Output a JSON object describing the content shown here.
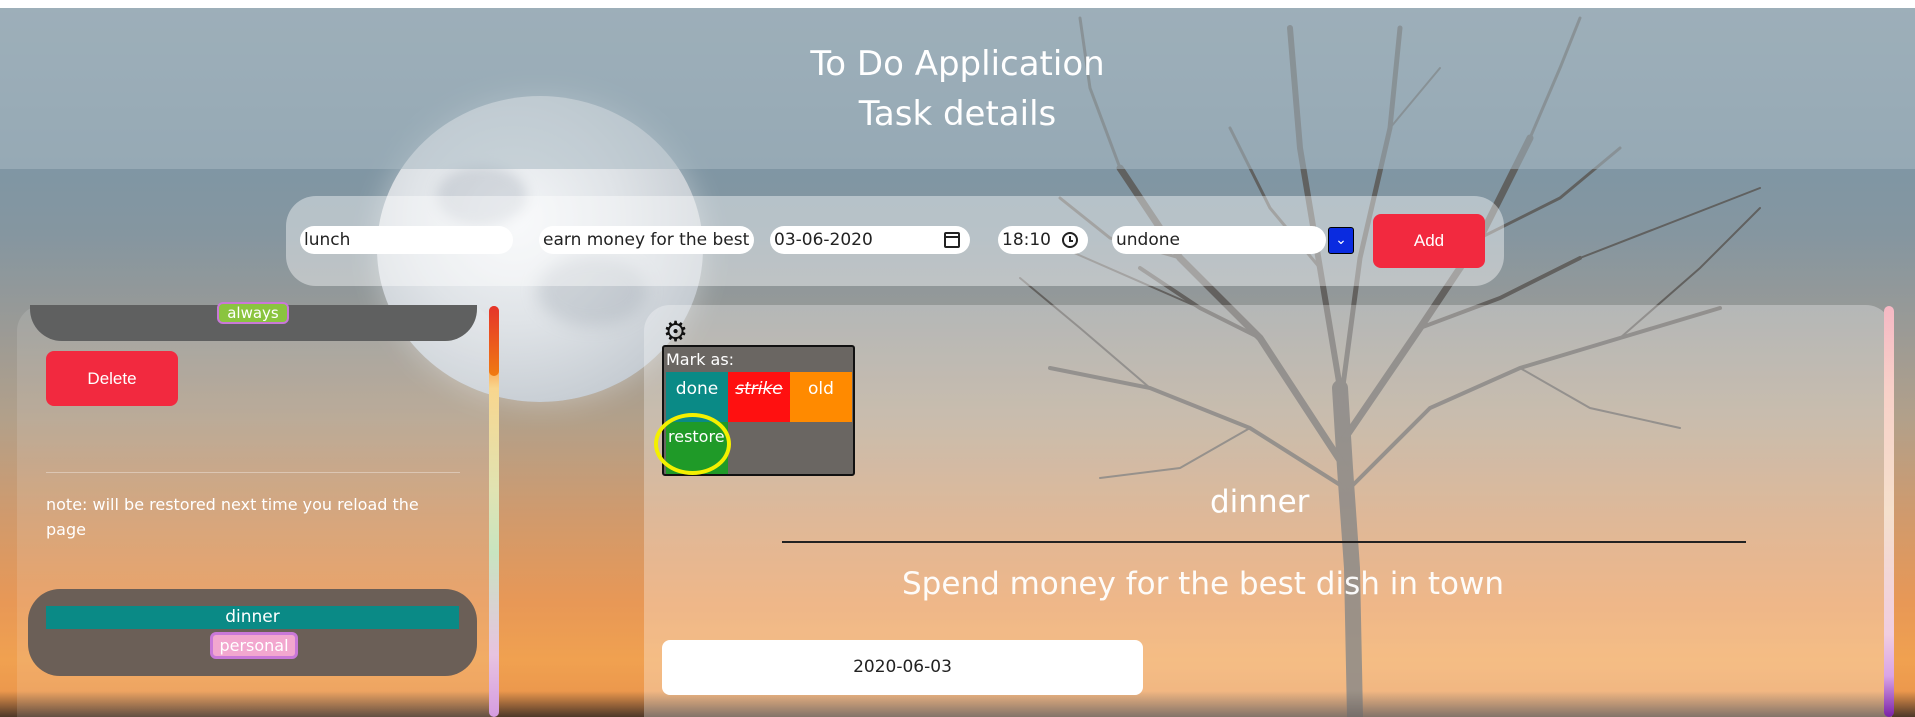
{
  "header": {
    "title": "To Do Application",
    "subtitle": "Task details"
  },
  "form": {
    "title_value": "lunch",
    "description_value": "earn money for the best",
    "date_value": "03-06-2020",
    "time_value": "18:10",
    "status_value": "undone",
    "add_label": "Add"
  },
  "left_panel": {
    "top_card_tag": "always",
    "delete_label": "Delete",
    "note": "note: will be restored next time you reload the page",
    "bottom_card": {
      "title": "dinner",
      "tag": "personal"
    }
  },
  "detail": {
    "menu_title": "Mark as:",
    "options": {
      "done": "done",
      "strike": "strike",
      "old": "old",
      "restore": "restore"
    },
    "task_title": "dinner",
    "task_description": "Spend money for the best dish in town",
    "task_date": "2020-06-03"
  },
  "colors": {
    "accent_red": "#f2293f",
    "teal": "#0a8a86",
    "highlight": "#f4f000"
  }
}
